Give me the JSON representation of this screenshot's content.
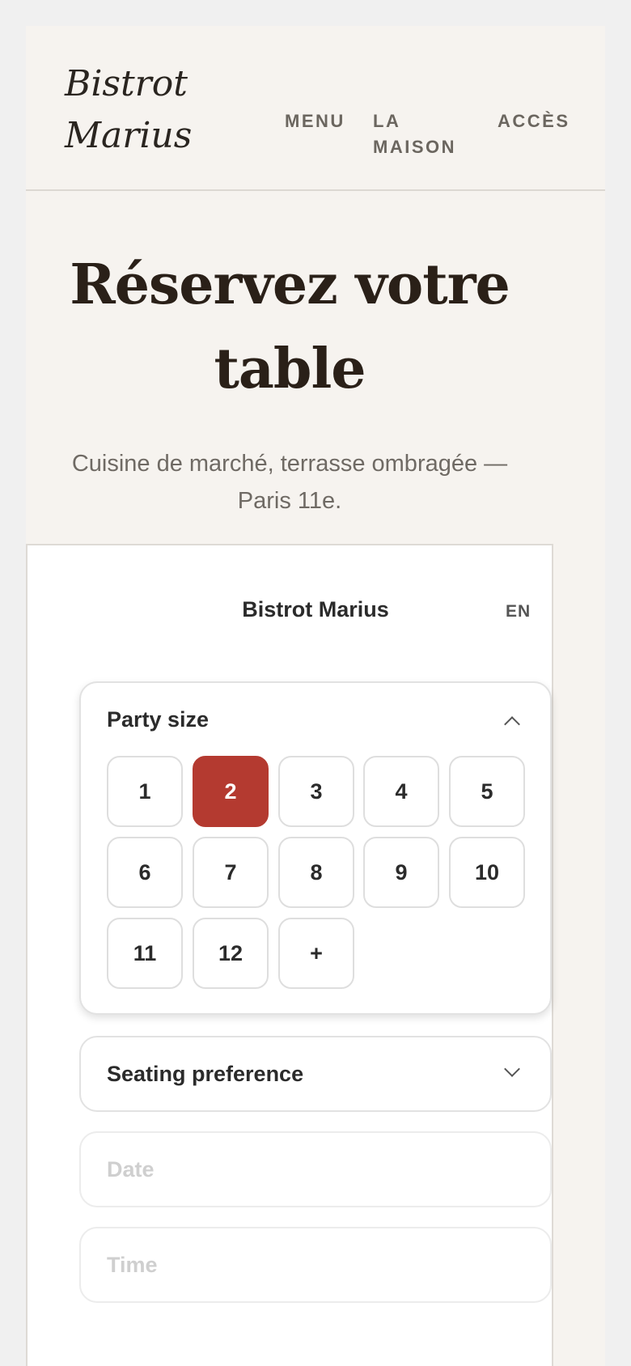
{
  "header": {
    "logo_line1": "Bistrot",
    "logo_line2": "Marius",
    "nav": {
      "menu": "MENU",
      "maison": "LA MAISON",
      "acces": "ACCÈS"
    }
  },
  "hero": {
    "title": "Réservez votre table",
    "subtitle": "Cuisine de marché, terrasse ombragée — Paris 11e."
  },
  "widget": {
    "title": "Bistrot Marius",
    "language": "EN",
    "party_size": {
      "label": "Party size",
      "options": [
        "1",
        "2",
        "3",
        "4",
        "5",
        "6",
        "7",
        "8",
        "9",
        "10",
        "11",
        "12",
        "+"
      ],
      "selected": "2",
      "expanded": true
    },
    "seating": {
      "label": "Seating preference",
      "expanded": false
    },
    "date": {
      "placeholder": "Date"
    },
    "time": {
      "placeholder": "Time"
    }
  },
  "colors": {
    "accent": "#b43a30",
    "page_bg": "#f6f3ef",
    "text_dark": "#2a2018"
  }
}
